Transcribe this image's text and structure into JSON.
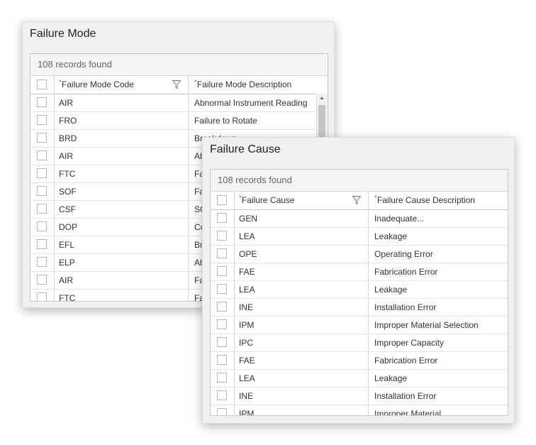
{
  "failure_mode": {
    "title": "Failure Mode",
    "records": "108 records found",
    "col_code": "Failure Mode Code",
    "col_desc": "Failure Mode Description",
    "rows": [
      {
        "code": "AIR",
        "desc": "Abnormal Instrument Reading"
      },
      {
        "code": "FRO",
        "desc": "Failure to Rotate"
      },
      {
        "code": "BRD",
        "desc": "Breakdown"
      },
      {
        "code": "AIR",
        "desc": "Ab"
      },
      {
        "code": "FTC",
        "desc": "Fa"
      },
      {
        "code": "SOF",
        "desc": "Fa"
      },
      {
        "code": "CSF",
        "desc": "SO"
      },
      {
        "code": "DOP",
        "desc": "Co"
      },
      {
        "code": "EFL",
        "desc": "Br"
      },
      {
        "code": "ELP",
        "desc": "Ab"
      },
      {
        "code": "AIR",
        "desc": "Fa"
      },
      {
        "code": "FTC",
        "desc": "Fa"
      }
    ]
  },
  "failure_cause": {
    "title": "Failure Cause",
    "records": "108 records found",
    "col_code": "Failure Cause",
    "col_desc": "Failure Cause Description",
    "rows": [
      {
        "code": "GEN",
        "desc": "Inadequate..."
      },
      {
        "code": "LEA",
        "desc": "Leakage"
      },
      {
        "code": "OPE",
        "desc": "Operating Error"
      },
      {
        "code": "FAE",
        "desc": "Fabrication Error"
      },
      {
        "code": "LEA",
        "desc": "Leakage"
      },
      {
        "code": "INE",
        "desc": "Installation Error"
      },
      {
        "code": "IPM",
        "desc": "Improper Material Selection"
      },
      {
        "code": "IPC",
        "desc": "Improper Capacity"
      },
      {
        "code": "FAE",
        "desc": "Fabrication Error"
      },
      {
        "code": "LEA",
        "desc": "Leakage"
      },
      {
        "code": "INE",
        "desc": "Installation Error"
      },
      {
        "code": "IPM",
        "desc": "Improper Material"
      }
    ]
  }
}
